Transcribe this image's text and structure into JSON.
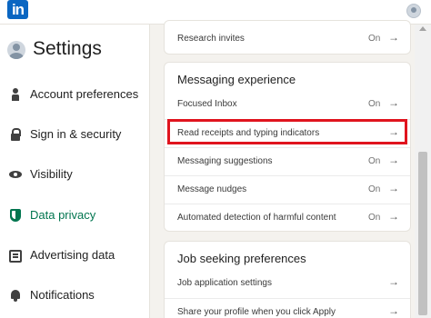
{
  "topbar": {
    "logo_text": "in"
  },
  "sidebar": {
    "title": "Settings",
    "items": [
      {
        "label": "Account preferences",
        "icon": "person-icon",
        "active": false
      },
      {
        "label": "Sign in & security",
        "icon": "lock-icon",
        "active": false
      },
      {
        "label": "Visibility",
        "icon": "eye-icon",
        "active": false
      },
      {
        "label": "Data privacy",
        "icon": "shield-icon",
        "active": true
      },
      {
        "label": "Advertising data",
        "icon": "ad-icon",
        "active": false
      },
      {
        "label": "Notifications",
        "icon": "bell-icon",
        "active": false
      }
    ]
  },
  "research_card": {
    "rows": [
      {
        "label": "Research invites",
        "status": "On",
        "arrow": "→"
      }
    ]
  },
  "messaging_card": {
    "title": "Messaging experience",
    "rows": [
      {
        "label": "Focused Inbox",
        "status": "On",
        "arrow": "→"
      },
      {
        "label": "Read receipts and typing indicators",
        "status": "",
        "arrow": "→"
      },
      {
        "label": "Messaging suggestions",
        "status": "On",
        "arrow": "→"
      },
      {
        "label": "Message nudges",
        "status": "On",
        "arrow": "→"
      },
      {
        "label": "Automated detection of harmful content",
        "status": "On",
        "arrow": "→"
      }
    ]
  },
  "job_card": {
    "title": "Job seeking preferences",
    "rows": [
      {
        "label": "Job application settings",
        "status": "",
        "arrow": "→"
      },
      {
        "label": "Share your profile when you click Apply",
        "status": "",
        "arrow": "→"
      }
    ]
  },
  "colors": {
    "brand": "#0a66c2",
    "active": "#01754f",
    "highlight": "#e0141e"
  }
}
